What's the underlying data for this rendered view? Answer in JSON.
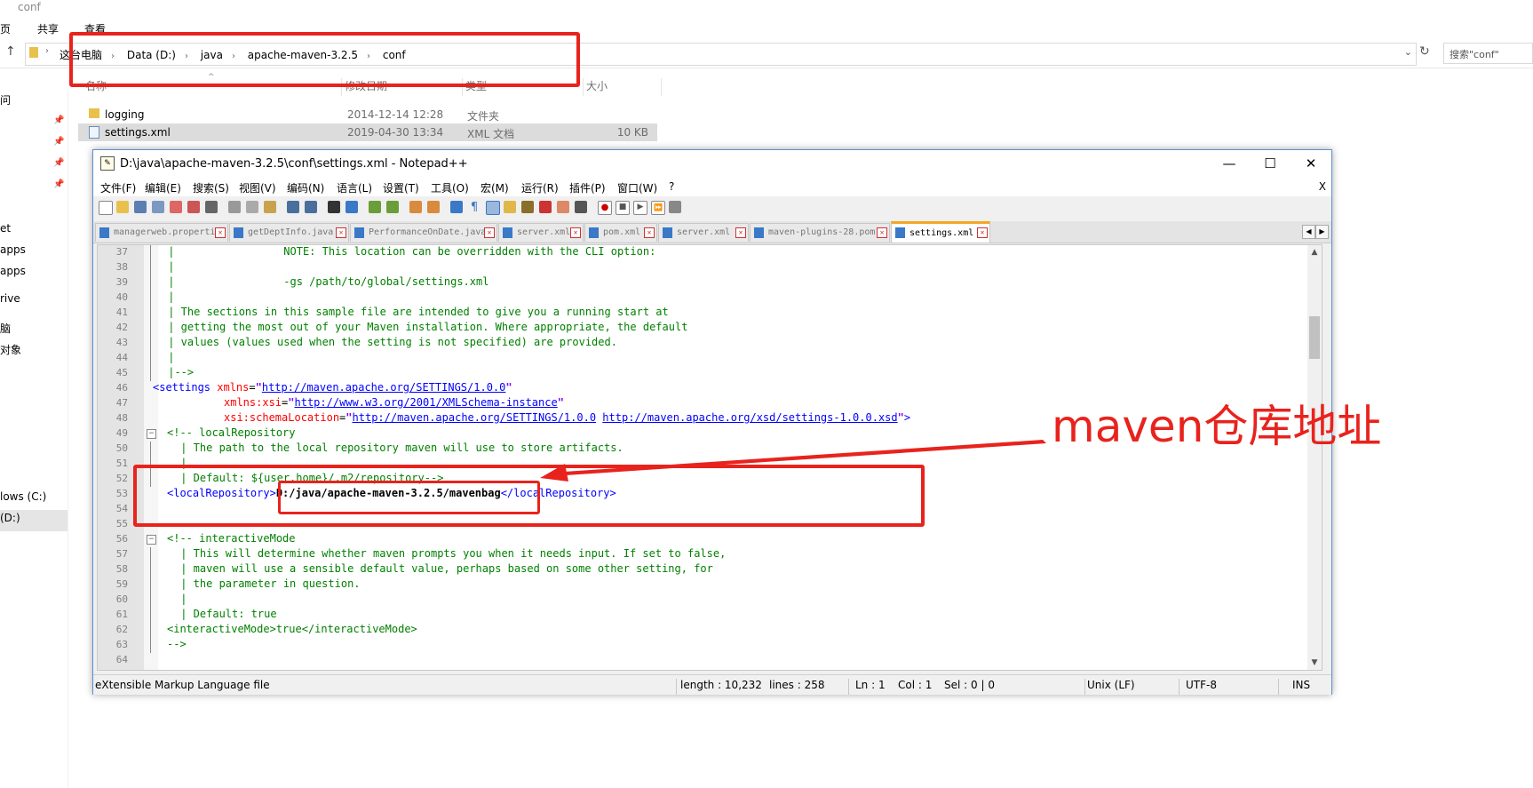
{
  "explorer": {
    "title": "conf",
    "ribbon_tabs": [
      "页",
      "共享",
      "查看"
    ],
    "breadcrumbs": [
      "这台电脑",
      "Data (D:)",
      "java",
      "apache-maven-3.2.5",
      "conf"
    ],
    "search_placeholder": "搜索\"conf\"",
    "columns": [
      "名称",
      "修改日期",
      "类型",
      "大小"
    ],
    "files": [
      {
        "name": "logging",
        "date": "2014-12-14 12:28",
        "type": "文件夹",
        "size": ""
      },
      {
        "name": "settings.xml",
        "date": "2019-04-30 13:34",
        "type": "XML 文档",
        "size": "10 KB"
      }
    ],
    "nav_items": [
      "问",
      "et",
      "apps",
      "apps",
      "rive",
      "脑",
      "对象",
      "lows (C:)",
      "(D:)"
    ]
  },
  "npp": {
    "title": "D:\\java\\apache-maven-3.2.5\\conf\\settings.xml - Notepad++",
    "close_x": "X",
    "menu": [
      "文件(F)",
      "编辑(E)",
      "搜索(S)",
      "视图(V)",
      "编码(N)",
      "语言(L)",
      "设置(T)",
      "工具(O)",
      "宏(M)",
      "运行(R)",
      "插件(P)",
      "窗口(W)",
      "?"
    ],
    "tabs": [
      "managerweb.properties",
      "getDeptInfo.java",
      "PerformanceOnDate.java",
      "server.xml",
      "pom.xml",
      "server.xml",
      "maven-plugins-28.pom",
      "settings.xml"
    ],
    "active_tab": "settings.xml",
    "status": {
      "filetype": "eXtensible Markup Language file",
      "length": "length : 10,232",
      "lines": "lines : 258",
      "ln": "Ln : 1",
      "col": "Col : 1",
      "sel": "Sel : 0 | 0",
      "eol": "Unix (LF)",
      "encoding": "UTF-8",
      "mode": "INS"
    }
  },
  "code": {
    "n37": "37",
    "c37": " |                 NOTE: This location can be overridden with the CLI option:",
    "n38": "38",
    "c38": " |",
    "n39": "39",
    "c39": " |                 -gs /path/to/global/settings.xml",
    "n40": "40",
    "c40": " |",
    "n41": "41",
    "c41": " | The sections in this sample file are intended to give you a running start at",
    "n42": "42",
    "c42": " | getting the most out of your Maven installation. Where appropriate, the default",
    "n43": "43",
    "c43": " | values (values used when the setting is not specified) are provided.",
    "n44": "44",
    "c44": " |",
    "n45": "45",
    "c45": " |-->",
    "n46": "46",
    "t46a": "<settings ",
    "a46a": "xmlns",
    "e46a": "=",
    "s46a": "\"",
    "l46a": "http://maven.apache.org/SETTINGS/1.0.0",
    "s46b": "\"",
    "n47": "47",
    "a47a": "xmlns:xsi",
    "e47a": "=",
    "s47a": "\"",
    "l47a": "http://www.w3.org/2001/XMLSchema-instance",
    "s47b": "\"",
    "n48": "48",
    "a48a": "xsi:schemaLocation",
    "e48a": "=",
    "s48a": "\"",
    "l48a": "http://maven.apache.org/SETTINGS/1.0.0",
    "l48b": "http://maven.apache.org/xsd/settings-1.0.0.xsd",
    "s48b": "\"",
    "t48b": ">",
    "n49": "49",
    "c49": "<!-- localRepository",
    "n50": "50",
    "c50": " | The path to the local repository maven will use to store artifacts.",
    "n51": "51",
    "c51": " |",
    "n52": "52",
    "c52": " | Default: ${user.home}/.m2/repository-->",
    "n53": "53",
    "t53a": "<localRepository>",
    "v53": "D:/java/apache-maven-3.2.5/mavenbag",
    "t53b": "</localRepository>",
    "n54": "54",
    "n55": "55",
    "n56": "56",
    "c56": "<!-- interactiveMode",
    "n57": "57",
    "c57": " | This will determine whether maven prompts you when it needs input. If set to false,",
    "n58": "58",
    "c58": " | maven will use a sensible default value, perhaps based on some other setting, for",
    "n59": "59",
    "c59": " | the parameter in question.",
    "n60": "60",
    "c60": " |",
    "n61": "61",
    "c61": " | Default: true",
    "n62": "62",
    "t62a": "<interactiveMode>",
    "v62": "true",
    "t62b": "</interactiveMode>",
    "n63": "63",
    "c63": "-->",
    "n64": "64"
  },
  "annotation": {
    "label": "maven仓库地址",
    "color": "#e8231d"
  }
}
